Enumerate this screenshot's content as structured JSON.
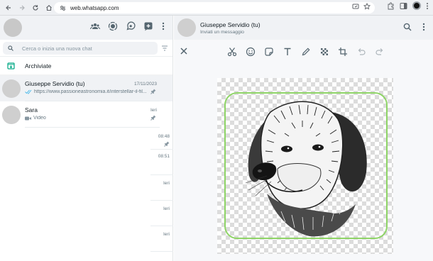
{
  "browser": {
    "url": "web.whatsapp.com"
  },
  "sidebar": {
    "search_placeholder": "Cerca o inizia una nuova chat",
    "archived_label": "Archiviate",
    "chats": [
      {
        "name": "Giuseppe Servidio (tu)",
        "time": "17/11/2023",
        "preview": "https://www.passioneastronomia.it/interstellar-il-fil...",
        "pinned": true,
        "active": true
      },
      {
        "name": "Sara",
        "time": "Ieri",
        "preview": "Video",
        "pinned": true,
        "active": false
      }
    ],
    "partial_times": [
      "08:48",
      "08:51",
      "Ieri",
      "Ieri",
      "Ieri"
    ]
  },
  "conversation": {
    "contact_name": "Giuseppe Servidio (tu)",
    "contact_subtitle": "Inviati un messaggio"
  },
  "editor": {
    "tools": [
      "scissors-icon",
      "emoji-icon",
      "sticker-icon",
      "text-icon",
      "pencil-icon",
      "pixelate-icon",
      "crop-icon",
      "undo-icon",
      "redo-icon"
    ]
  },
  "colors": {
    "sticker_outline": "#8ed466",
    "panel_bg": "#f0f2f5",
    "accent": "#00a884"
  }
}
